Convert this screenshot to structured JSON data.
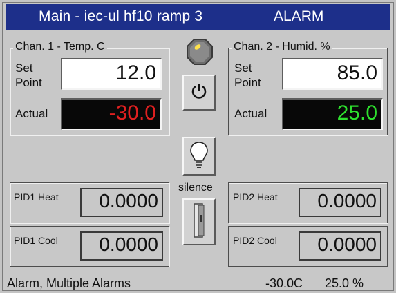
{
  "window": {
    "title": "Main - iec-ul hf10 ramp 3",
    "status": "ALARM"
  },
  "channel1": {
    "title": "Chan. 1 - Temp. C",
    "setpoint_label": "Set\nPoint",
    "setpoint_value": "12.0",
    "actual_label": "Actual",
    "actual_value": "-30.0",
    "actual_color": "#e02020"
  },
  "channel2": {
    "title": "Chan. 2 - Humid. %",
    "setpoint_label": "Set\nPoint",
    "setpoint_value": "85.0",
    "actual_label": "Actual",
    "actual_value": "25.0",
    "actual_color": "#2ee02e"
  },
  "center": {
    "indicator_icon": "hexagon-indicator-icon",
    "power_icon": "power-icon",
    "light_icon": "lightbulb-icon",
    "silence_label": "silence",
    "door_icon": "door-icon"
  },
  "pid": {
    "pid1_heat_label": "PID1 Heat",
    "pid1_heat_value": "0.0000",
    "pid1_cool_label": "PID1 Cool",
    "pid1_cool_value": "0.0000",
    "pid2_heat_label": "PID2 Heat",
    "pid2_heat_value": "0.0000",
    "pid2_cool_label": "PID2 Cool",
    "pid2_cool_value": "0.0000"
  },
  "statusbar": {
    "message": "Alarm, Multiple Alarms",
    "temp_reading": "-30.0C",
    "humid_reading": "25.0 %"
  }
}
